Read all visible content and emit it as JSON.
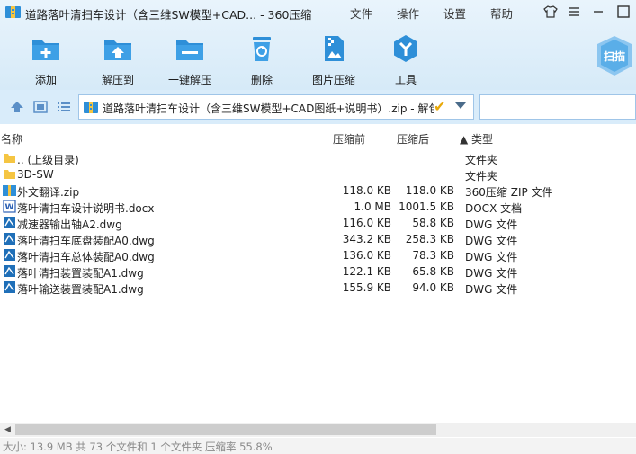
{
  "window": {
    "title": "道路落叶清扫车设计（含三维SW模型+CAD... - 360压缩",
    "menus": [
      "文件",
      "操作",
      "设置",
      "帮助"
    ],
    "controls": [
      "skin-icon",
      "menu-icon",
      "minimize-icon",
      "close-icon"
    ]
  },
  "toolbar": {
    "items": [
      {
        "label": "添加",
        "icon": "add-icon"
      },
      {
        "label": "解压到",
        "icon": "extract-to-icon"
      },
      {
        "label": "一键解压",
        "icon": "one-click-extract-icon"
      },
      {
        "label": "删除",
        "icon": "delete-icon"
      },
      {
        "label": "图片压缩",
        "icon": "image-compress-icon"
      },
      {
        "label": "工具",
        "icon": "tools-icon"
      }
    ],
    "scan_label": "扫描"
  },
  "addressbar": {
    "path": "道路落叶清扫车设计（含三维SW模型+CAD图纸+说明书）.zip - 解包",
    "search_placeholder": ""
  },
  "columns": {
    "name": "名称",
    "packed": "压缩前",
    "unpacked": "压缩后",
    "type": "▲ 类型"
  },
  "files": [
    {
      "name": ".. (上级目录)",
      "packed": "",
      "unpacked": "",
      "type": "文件夹",
      "icon": "folder-up"
    },
    {
      "name": "3D-SW",
      "packed": "",
      "unpacked": "",
      "type": "文件夹",
      "icon": "folder"
    },
    {
      "name": "外文翻译.zip",
      "packed": "118.0 KB",
      "unpacked": "118.0 KB",
      "type": "360压缩 ZIP 文件",
      "icon": "zip"
    },
    {
      "name": "落叶清扫车设计说明书.docx",
      "packed": "1.0 MB",
      "unpacked": "1001.5 KB",
      "type": "DOCX 文档",
      "icon": "docx"
    },
    {
      "name": "减速器输出轴A2.dwg",
      "packed": "116.0 KB",
      "unpacked": "58.8 KB",
      "type": "DWG 文件",
      "icon": "dwg"
    },
    {
      "name": "落叶清扫车底盘装配A0.dwg",
      "packed": "343.2 KB",
      "unpacked": "258.3 KB",
      "type": "DWG 文件",
      "icon": "dwg"
    },
    {
      "name": "落叶清扫车总体装配A0.dwg",
      "packed": "136.0 KB",
      "unpacked": "78.3 KB",
      "type": "DWG 文件",
      "icon": "dwg"
    },
    {
      "name": "落叶清扫装置装配A1.dwg",
      "packed": "122.1 KB",
      "unpacked": "65.8 KB",
      "type": "DWG 文件",
      "icon": "dwg"
    },
    {
      "name": "落叶输送装置装配A1.dwg",
      "packed": "155.9 KB",
      "unpacked": "94.0 KB",
      "type": "DWG 文件",
      "icon": "dwg"
    }
  ],
  "status": "大小: 13.9 MB 共 73 个文件和 1 个文件夹 压缩率 55.8%",
  "colors": {
    "accent": "#2e8fd8",
    "toolbar_bg": "#e3f1fb",
    "folder": "#f5c542"
  }
}
